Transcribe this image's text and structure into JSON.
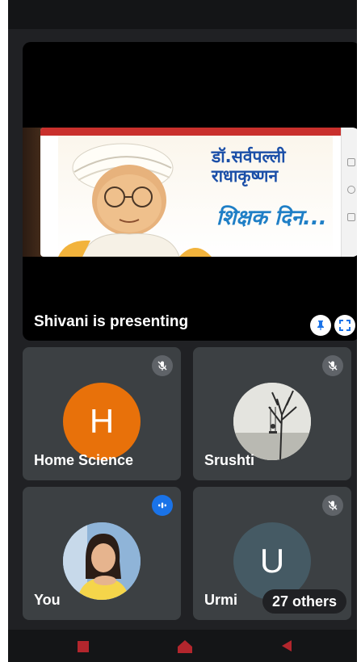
{
  "presentation": {
    "label": "Shivani is presenting",
    "slide_title": "डॉ.सर्वपल्ली राधाकृष्णन",
    "slide_subtitle": "शिक्षक दिन..."
  },
  "participants": [
    {
      "name": "Home Science",
      "initial": "H",
      "avatar_color": "#e8710a",
      "muted": true
    },
    {
      "name": "Srushti",
      "muted": true
    },
    {
      "name": "You",
      "speaking": true
    },
    {
      "name": "Urmi",
      "initial": "U",
      "avatar_color": "#455a64",
      "muted": true
    }
  ],
  "others": {
    "label": "27 others"
  },
  "colors": {
    "background": "#202124",
    "tile": "#3c4043",
    "accent": "#1a73e8"
  }
}
